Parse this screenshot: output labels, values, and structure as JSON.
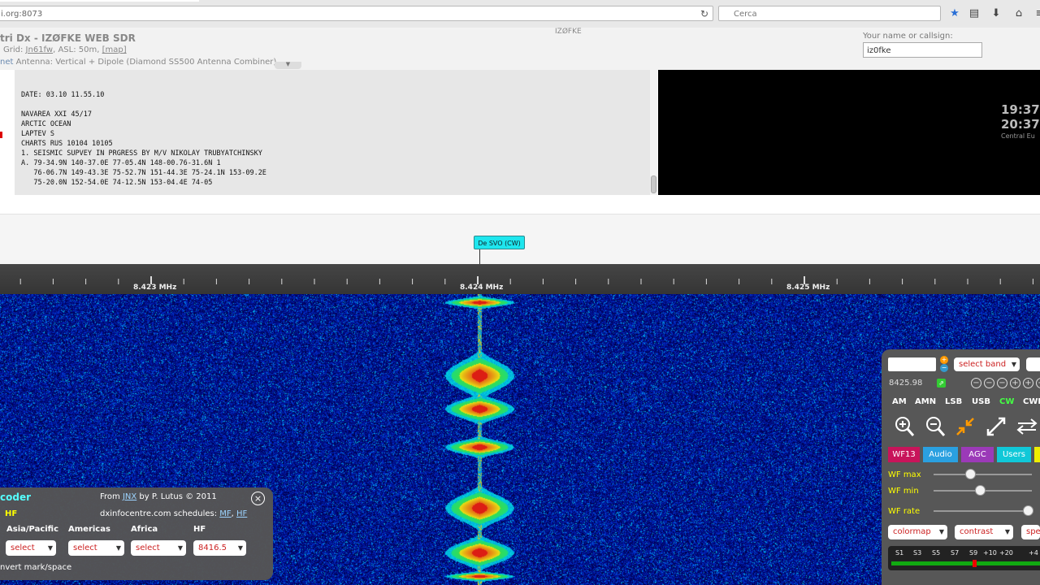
{
  "browser": {
    "url": "i.org:8073",
    "search_placeholder": "Cerca",
    "icons": [
      "reload-icon",
      "search-icon",
      "bookmark-star-icon",
      "reading-list-icon",
      "download-icon",
      "home-icon",
      "menu-icon"
    ]
  },
  "header": {
    "title": "tri Dx - IZØFKE WEB SDR",
    "grid_prefix": "Grid: ",
    "grid_link": "Jn61fw",
    "asl": ", ASL: 50m, ",
    "map_link": "[map]",
    "antenna_prefix": "net",
    "antenna": " Antenna: Vertical + Dipole (Diamond SS500 Antenna Combiner)",
    "center_callsign": "IZØFKE",
    "name_label": "Your name or callsign:",
    "name_value": "iz0fke"
  },
  "decoded_text": "DATE: 03.10 11.55.10\n\nNAVAREA XXI 45/17\nARCTIC OCEAN\nLAPTEV S\nCHARTS RUS 10104 10105\n1. SEISMIC SUPVEY IN PRGRESS BY M/V NIKOLAY TRUBYATCHINSKY\nA. 79-34.9N 140-37.0E 77-05.4N 148-00.76-31.6N 1\n   76-06.7N 149-43.3E 75-52.7N 151-44.3E 75-24.1N 153-09.2E\n   75-20.0N 152-54.0E 74-12.5N 153-04.4E 74-05",
  "clock": {
    "utc": "19:37",
    "local": "20:37",
    "tz": "Central Eu"
  },
  "station_label": "De SVO (CW)",
  "scale": {
    "labels": [
      "8.423 MHz",
      "8.424 MHz",
      "8.425 MHz"
    ]
  },
  "decoder": {
    "title": "coder",
    "band_label": "HF",
    "from_prefix": "From ",
    "from_link": "JNX",
    "from_suffix": " by P. Lutus © 2011",
    "sched_prefix": "dxinfocentre.com schedules: ",
    "sched_mf": "MF",
    "sched_comma": ", ",
    "sched_hf": "HF",
    "close": "×",
    "columns": [
      "Asia/Pacific",
      "Americas",
      "Africa",
      "HF"
    ],
    "selects": [
      "select",
      "select",
      "select",
      "8416.5"
    ],
    "invert": "nvert mark/space"
  },
  "controls": {
    "band_select": "select band",
    "freq_readout": "8425.98",
    "modes": [
      "AM",
      "AMN",
      "LSB",
      "USB",
      "CW",
      "CWN"
    ],
    "active_mode": "CW",
    "tabs": [
      "WF13",
      "Audio",
      "AGC",
      "Users"
    ],
    "tab_colors": [
      "#c8145a",
      "#2aa0e0",
      "#9b3ab8",
      "#10c8d8"
    ],
    "sliders": [
      {
        "label": "WF max",
        "value": 0.37
      },
      {
        "label": "WF min",
        "value": 0.47
      },
      {
        "label": "WF rate",
        "value": 0.96
      }
    ],
    "bottom_selects": [
      "colormap",
      "contrast",
      "spe"
    ],
    "smeter_labels": [
      "S1",
      "S3",
      "S5",
      "S7",
      "S9",
      "+10",
      "+20",
      "+4"
    ],
    "icons": [
      "zoom-in-icon",
      "zoom-out-icon",
      "zoom-max-in-icon",
      "zoom-max-out-icon",
      "swap-icon"
    ]
  }
}
